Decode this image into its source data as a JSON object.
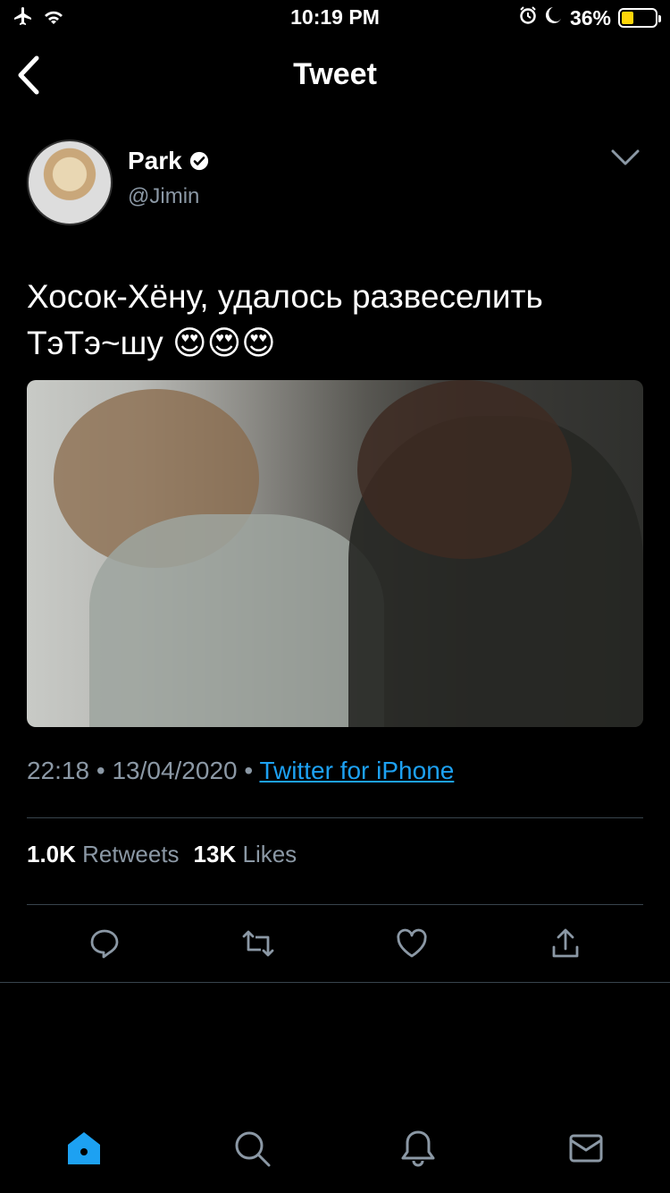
{
  "status_bar": {
    "time": "10:19 PM",
    "battery_percent": "36%",
    "battery_level": 0.36,
    "icons": [
      "airplane-icon",
      "wifi-icon",
      "alarm-icon",
      "moon-icon",
      "battery-icon"
    ]
  },
  "nav": {
    "title": "Tweet",
    "back_icon": "chevron-left-icon"
  },
  "tweet": {
    "author_name": "Park",
    "author_handle": "@Jimin",
    "verified": true,
    "text_line1": "Хосок-Хёну, удалось развеселить",
    "text_line2": "ТэТэ~шу 😍😍😍",
    "time": "22:18",
    "date": "13/04/2020",
    "separator": "•",
    "source": "Twitter for iPhone",
    "retweets_count": "1.0K",
    "retweets_label": "Retweets",
    "likes_count": "13K",
    "likes_label": "Likes"
  },
  "actions": [
    "reply-icon",
    "retweet-icon",
    "like-icon",
    "share-icon"
  ],
  "tabbar": [
    "home-icon",
    "search-icon",
    "notifications-icon",
    "messages-icon"
  ],
  "colors": {
    "background": "#000000",
    "accent": "#1da1f2",
    "secondary_text": "#8b98a5",
    "divider": "#38444d",
    "battery_charge": "#ffd60a"
  }
}
